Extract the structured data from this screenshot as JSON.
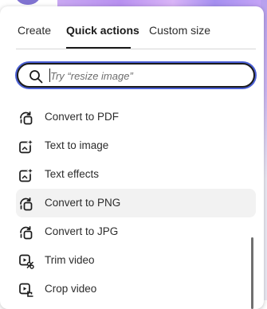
{
  "tabs": [
    {
      "label": "Create"
    },
    {
      "label": "Quick actions",
      "active": true
    },
    {
      "label": "Custom size"
    }
  ],
  "search": {
    "placeholder": "Try “resize image”",
    "value": "",
    "icon": "search-icon"
  },
  "actions": [
    {
      "label": "Convert to PDF",
      "icon": "convert-icon"
    },
    {
      "label": "Text to image",
      "icon": "sparkle-image-icon"
    },
    {
      "label": "Text effects",
      "icon": "sparkle-image-icon"
    },
    {
      "label": "Convert to PNG",
      "icon": "convert-icon",
      "hover": true
    },
    {
      "label": "Convert to JPG",
      "icon": "convert-icon"
    },
    {
      "label": "Trim video",
      "icon": "trim-video-icon"
    },
    {
      "label": "Crop video",
      "icon": "crop-video-icon"
    }
  ],
  "colors": {
    "accent_focus": "#4b60d6",
    "text": "#2c2c2c",
    "hover_bg": "#f2f2f2"
  }
}
